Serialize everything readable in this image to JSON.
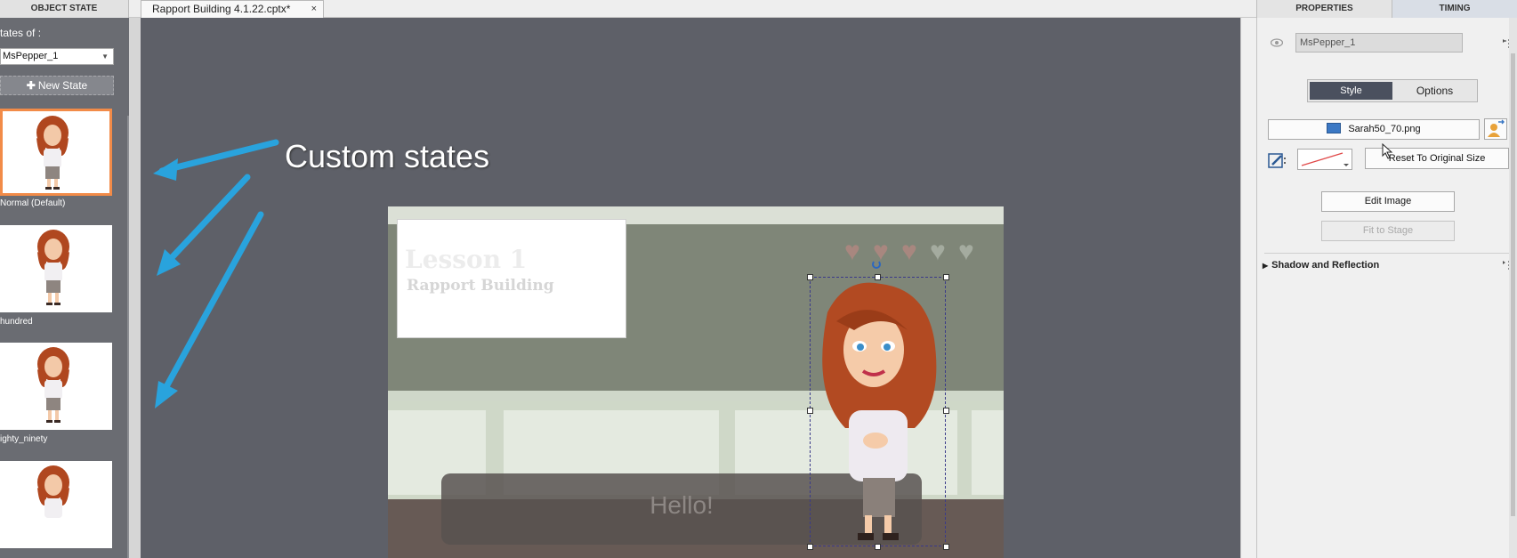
{
  "tabs": {
    "object_state": "OBJECT STATE",
    "document": "Rapport Building 4.1.22.cptx*",
    "document_close": "×",
    "properties": "PROPERTIES",
    "timing": "TIMING"
  },
  "object_state_panel": {
    "states_of_label": "tates of :",
    "selected_object": "MsPepper_1",
    "new_state_label": "New State",
    "states": [
      {
        "label": "Normal (Default)",
        "selected": true
      },
      {
        "label": "hundred",
        "selected": false
      },
      {
        "label": "ighty_ninety",
        "selected": false
      },
      {
        "label": "",
        "selected": false
      }
    ]
  },
  "annotation": {
    "callout": "Custom states",
    "arrow_color": "#29a3dd"
  },
  "slide": {
    "lesson_title": "Lesson 1",
    "lesson_subtitle": "Rapport Building",
    "bubble_text": "Hello!",
    "hearts_filled": 3,
    "hearts_total": 5,
    "heart_filled_color": "#a8877f",
    "heart_empty_color": "#a4ab9f"
  },
  "properties_panel": {
    "object_name": "MsPepper_1",
    "style_tab": "Style",
    "options_tab": "Options",
    "image_file": "Sarah50_70.png",
    "reset_button": "Reset To Original Size",
    "edit_image_button": "Edit Image",
    "fit_to_stage_button": "Fit to Stage",
    "shadow_section": "Shadow and Reflection"
  },
  "colors": {
    "selection_border": "#f28b48",
    "style_tab_active": "#4a505e"
  }
}
